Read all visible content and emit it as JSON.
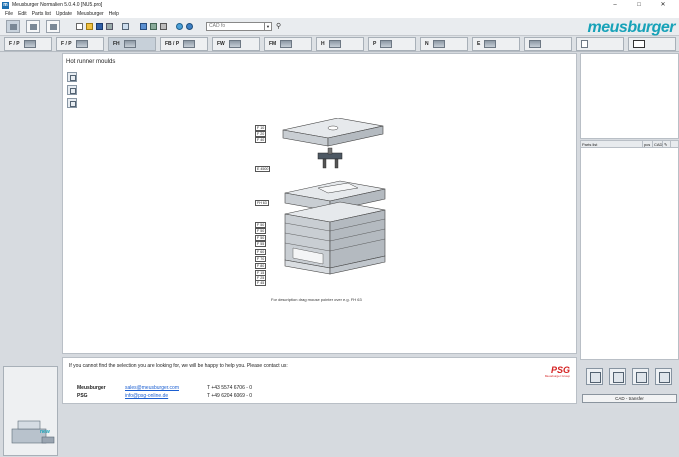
{
  "window": {
    "title": "Meusburger Normalien 5.0.4.0 [NU5.pro]",
    "app_icon": "m",
    "controls": [
      "–",
      "□",
      "✕"
    ]
  },
  "menu": [
    "File",
    "Edit",
    "Parts list",
    "Update",
    "Meusburger",
    "Help"
  ],
  "toolbar": {
    "search_value": "CAD fo",
    "logo": "meusburger"
  },
  "tabs": [
    {
      "label": "F / P"
    },
    {
      "label": "F / P"
    },
    {
      "label": "FH"
    },
    {
      "label": "FB / P"
    },
    {
      "label": "FW"
    },
    {
      "label": "FM"
    },
    {
      "label": "H"
    },
    {
      "label": "P"
    },
    {
      "label": "N"
    },
    {
      "label": "E"
    },
    {
      "label": ""
    },
    {
      "label": ""
    }
  ],
  "left": {
    "new_badge": "new"
  },
  "main": {
    "heading": "Hot runner moulds",
    "caption": "For description drag mouse pointer over e.g. FH 63",
    "labels_top": [
      "F 10",
      "F 20",
      "F 40"
    ],
    "label_e": "E 4500",
    "label_fh": "FH 63",
    "labels_bottom": [
      "F 50",
      "F 50",
      "F 50",
      "F 55",
      "F 60",
      "F 70",
      "F 80",
      "F 15",
      "F 25",
      "F 45"
    ]
  },
  "contact": {
    "message": "If you cannot find the selection you are looking for, we will be happy to help you. Please contact us:",
    "rows": [
      {
        "name": "Meusburger",
        "email": "sales@meusburger.com",
        "phone": "T +43 5574 6706 - 0"
      },
      {
        "name": "PSG",
        "email": "info@psg-online.de",
        "phone": "T +49 6204 6069 - 0"
      }
    ],
    "psg_logo": "PSG",
    "psg_sub": "Meusburger Group"
  },
  "right": {
    "partslist_headers": [
      "Parts list",
      "pcs",
      "CAD",
      "✎"
    ],
    "cad_transfer": "CAD - transfer"
  }
}
